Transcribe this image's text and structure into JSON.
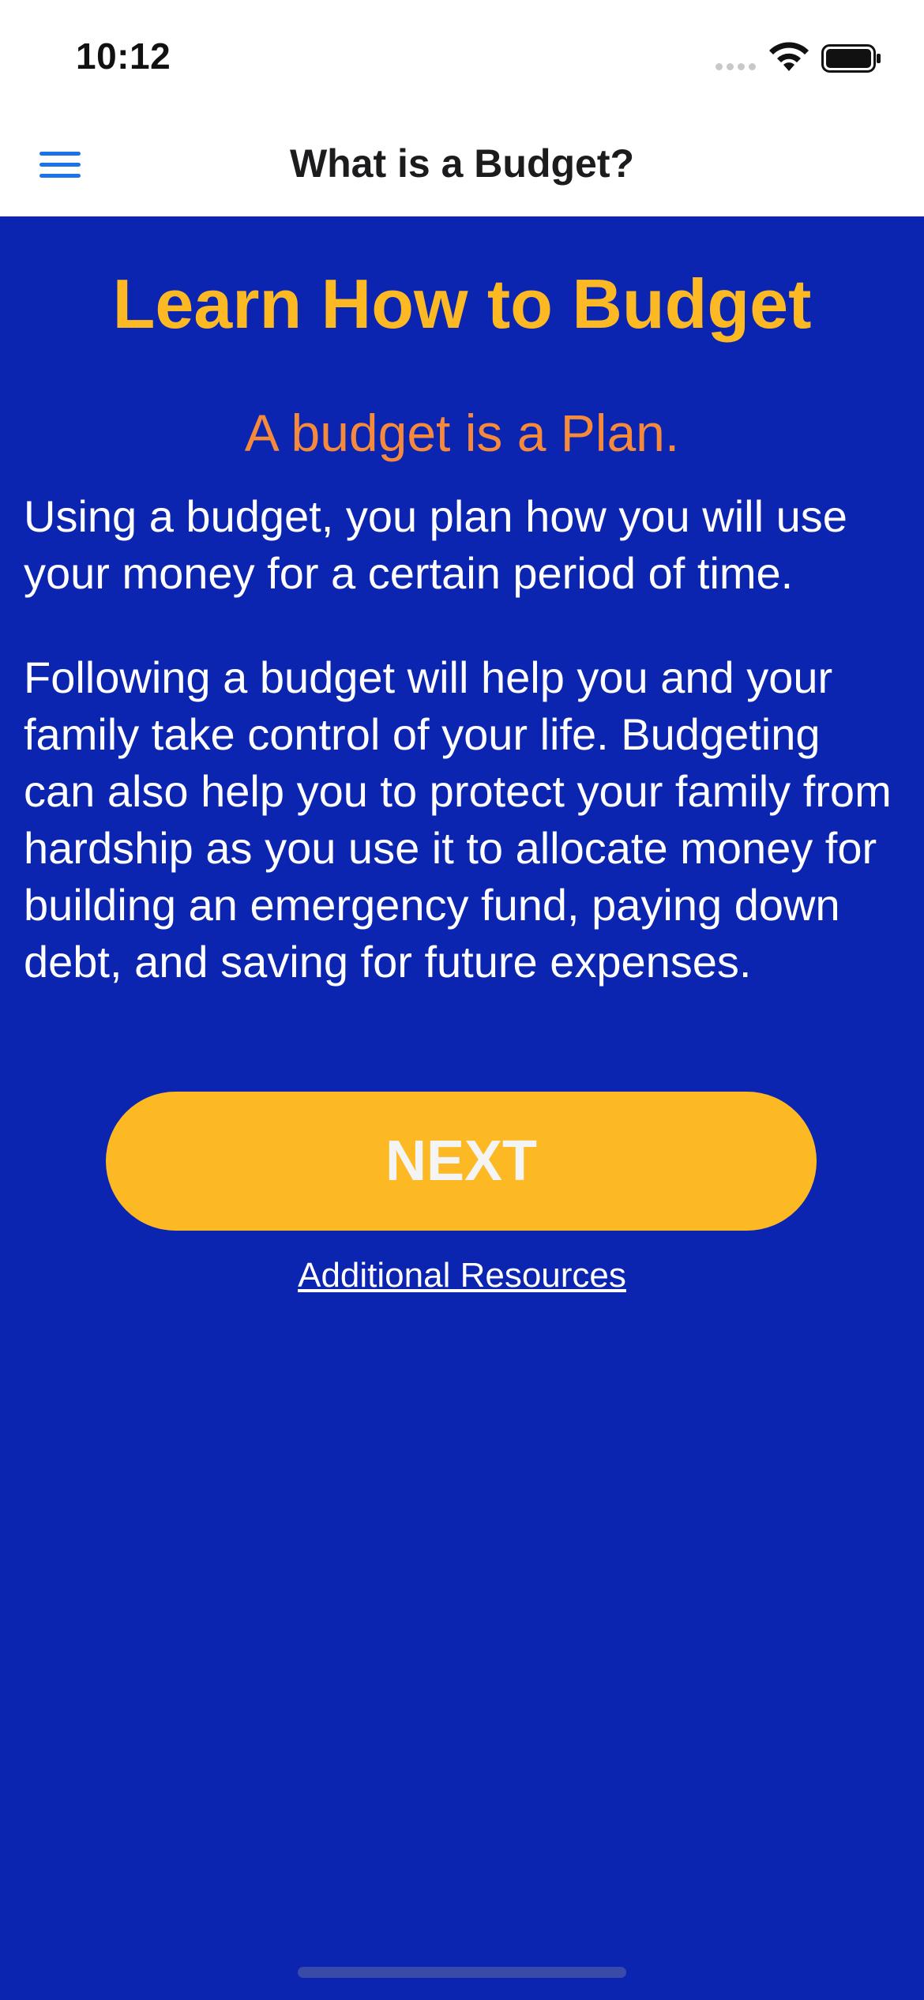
{
  "status_bar": {
    "time": "10:12",
    "signal_icon": "signal-dots-icon",
    "wifi_icon": "wifi-icon",
    "battery_icon": "battery-icon"
  },
  "nav": {
    "title": "What is a Budget?",
    "menu_icon": "hamburger-menu-icon"
  },
  "content": {
    "title": "Learn How to Budget",
    "subtitle": "A budget is a Plan.",
    "paragraphs": [
      "Using a budget, you plan how you will use your money for a certain period of time.",
      "Following a budget will help you and your family take control of your life. Budgeting can also help you to protect your family from hardship as you use it to allocate money for building an emergency fund, paying down debt, and saving for future expenses."
    ],
    "next_label": "NEXT",
    "resources_label": "Additional Resources"
  },
  "colors": {
    "background": "#0b25b0",
    "accent_yellow": "#fdb924",
    "subtitle_orange": "#f58a3c",
    "menu_blue": "#1a73e8",
    "text_white": "#ffffff"
  }
}
